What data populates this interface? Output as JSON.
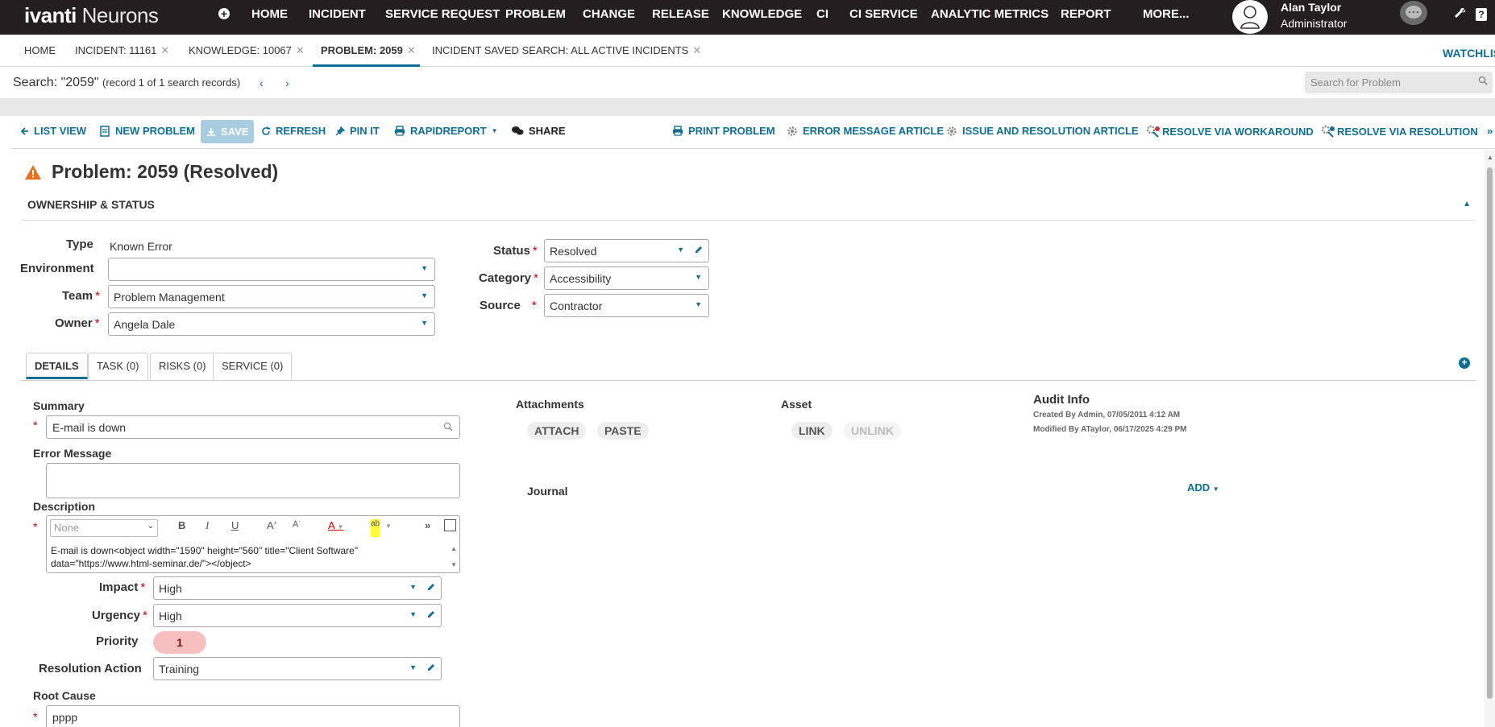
{
  "brand": {
    "logo_main": "ivanti",
    "logo_sub": "Neurons"
  },
  "nav": {
    "items": [
      "HOME",
      "INCIDENT",
      "SERVICE REQUEST",
      "PROBLEM",
      "CHANGE",
      "RELEASE",
      "KNOWLEDGE",
      "CI",
      "CI SERVICE",
      "ANALYTIC METRICS",
      "REPORT",
      "MORE..."
    ]
  },
  "user": {
    "name": "Alan Taylor",
    "role": "Administrator"
  },
  "tabs": [
    {
      "label": "HOME",
      "closable": false
    },
    {
      "label": "INCIDENT: 11161",
      "closable": true
    },
    {
      "label": "KNOWLEDGE: 10067",
      "closable": true
    },
    {
      "label": "PROBLEM: 2059",
      "closable": true,
      "active": true
    },
    {
      "label": "INCIDENT SAVED SEARCH: ALL ACTIVE INCIDENTS",
      "closable": true
    }
  ],
  "watchlist": "WATCHLIS",
  "search": {
    "query_label": "Search: \"2059\"",
    "record_info": "(record 1 of 1 search records)",
    "placeholder": "Search for Problem"
  },
  "toolbar": {
    "list_view": "LIST VIEW",
    "new_problem": "NEW PROBLEM",
    "save": "SAVE",
    "refresh": "REFRESH",
    "pin_it": "PIN IT",
    "rapidreport": "RAPIDREPORT",
    "share": "SHARE",
    "print_problem": "PRINT PROBLEM",
    "error_message_article": "ERROR MESSAGE ARTICLE",
    "issue_resolution_article": "ISSUE AND RESOLUTION ARTICLE",
    "resolve_workaround": "RESOLVE VIA WORKAROUND",
    "resolve_resolution": "RESOLVE VIA RESOLUTION",
    "more": "»"
  },
  "record": {
    "title": "Problem: 2059 (Resolved)",
    "section": "OWNERSHIP & STATUS"
  },
  "fields": {
    "type_label": "Type",
    "type_value": "Known Error",
    "environment_label": "Environment",
    "environment_value": "",
    "team_label": "Team",
    "team_value": "Problem Management",
    "owner_label": "Owner",
    "owner_value": "Angela Dale",
    "status_label": "Status",
    "status_value": "Resolved",
    "category_label": "Category",
    "category_value": "Accessibility",
    "source_label": "Source",
    "source_value": "Contractor"
  },
  "subtabs": [
    "DETAILS",
    "TASK (0)",
    "RISKS (0)",
    "SERVICE (0)"
  ],
  "details": {
    "summary_label": "Summary",
    "summary_value": "E-mail is down",
    "error_message_label": "Error Message",
    "error_message_value": "",
    "description_label": "Description",
    "rte_format": "None",
    "description_line1": "E-mail is down<object width=\"1590\" height=\"560\" title=\"Client Software\"",
    "description_line2": "data=\"https://www.html-seminar.de/\"></object>",
    "impact_label": "Impact",
    "impact_value": "High",
    "urgency_label": "Urgency",
    "urgency_value": "High",
    "priority_label": "Priority",
    "priority_value": "1",
    "resolution_action_label": "Resolution Action",
    "resolution_action_value": "Training",
    "root_cause_label": "Root Cause",
    "root_cause_value": "pppp"
  },
  "attachments": {
    "label": "Attachments",
    "attach": "ATTACH",
    "paste": "PASTE"
  },
  "asset": {
    "label": "Asset",
    "link": "LINK",
    "unlink": "UNLINK"
  },
  "audit": {
    "label": "Audit Info",
    "created": "Created By Admin, 07/05/2011 4:12 AM",
    "modified": "Modified By ATaylor, 06/17/2025 4:29 PM"
  },
  "journal": {
    "label": "Journal",
    "add": "ADD"
  },
  "colors": {
    "nav_bg": "#231f20",
    "accent": "#0f6e93",
    "required": "#cc0000",
    "priority_pill": "#f6c0c0"
  }
}
